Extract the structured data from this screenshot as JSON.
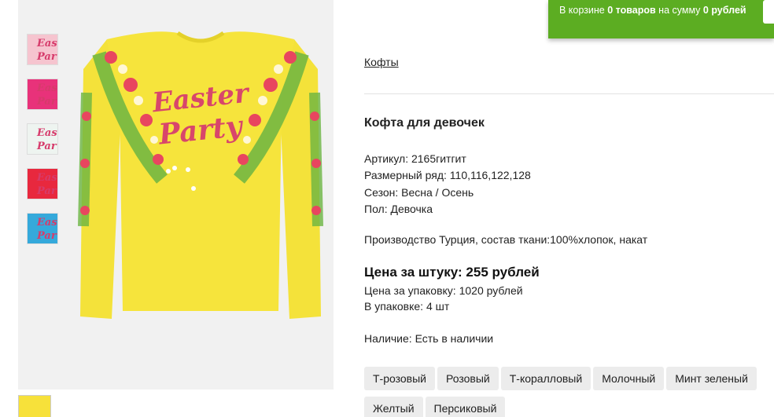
{
  "cart": {
    "prefix": "В корзине ",
    "count": "0 товаров",
    "middle": " на сумму ",
    "sum": "0 рублей"
  },
  "gallery": {
    "thumbnails": [
      {
        "text": "Eas Par",
        "bg": "#f6c4cf"
      },
      {
        "text": "Eas Par",
        "bg": "#e8327a"
      },
      {
        "text": "Eas Par",
        "bg": "#eef4f0"
      },
      {
        "text": "Eas Par",
        "bg": "#e8283e"
      },
      {
        "text": "Eas Par",
        "bg": "#35a9db"
      }
    ],
    "main_text_line1": "Easter",
    "main_text_line2": "Party",
    "shirt_color": "#f4e23a"
  },
  "breadcrumb": "Кофты",
  "product": {
    "title": "Кофта для девочек",
    "article": "Артикул: 2165гитгит",
    "sizes": "Размерный ряд: 110,116,122,128",
    "season": "Сезон: Весна / Осень",
    "gender": "Пол: Девочка",
    "production": "Производство Турция, состав ткани:100%хлопок, накат",
    "price_unit": "Цена за штуку: 255 рублей",
    "price_pack": "Цена за упаковку: 1020 рублей",
    "pack_qty": "В упаковке: 4 шт",
    "availability": "Наличие: Есть в наличии",
    "colors": [
      "Т-розовый",
      "Розовый",
      "Т-коралловый",
      "Молочный",
      "Минт зеленый",
      "Желтый",
      "Персиковый"
    ]
  },
  "theme": {
    "cart_bg": "#5cad22",
    "chip_bg": "#ececec"
  }
}
